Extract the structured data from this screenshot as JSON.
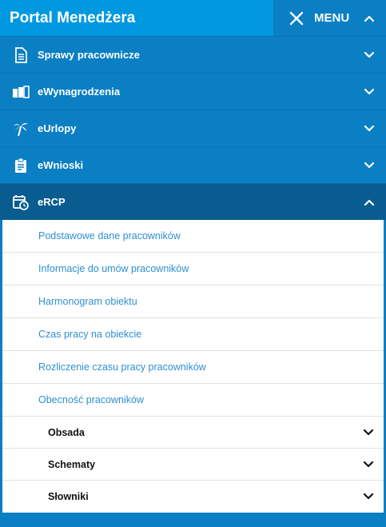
{
  "header": {
    "title": "Portal Menedżera",
    "menu_label": "MENU"
  },
  "sections": [
    {
      "label": "Sprawy pracownicze",
      "icon": "document-icon",
      "expanded": false
    },
    {
      "label": "eWynagrodzenia",
      "icon": "money-icon",
      "expanded": false
    },
    {
      "label": "eUrlopy",
      "icon": "palm-tree-icon",
      "expanded": false
    },
    {
      "label": "eWnioski",
      "icon": "clipboard-icon",
      "expanded": false
    },
    {
      "label": "eRCP",
      "icon": "calendar-clock-icon",
      "expanded": true
    }
  ],
  "ercp": {
    "links": [
      "Podstawowe dane pracowników",
      "Informacje do umów pracowników",
      "Harmonogram obiektu",
      "Czas pracy na obiekcie",
      "Rozliczenie czasu pracy pracowników",
      "Obecność pracowników"
    ],
    "groups": [
      "Obsada",
      "Schematy",
      "Słowniki"
    ]
  },
  "colors": {
    "brand": "#0099e0",
    "nav": "#0a7fc4",
    "active": "#095c90",
    "link": "#2f8fd0"
  }
}
